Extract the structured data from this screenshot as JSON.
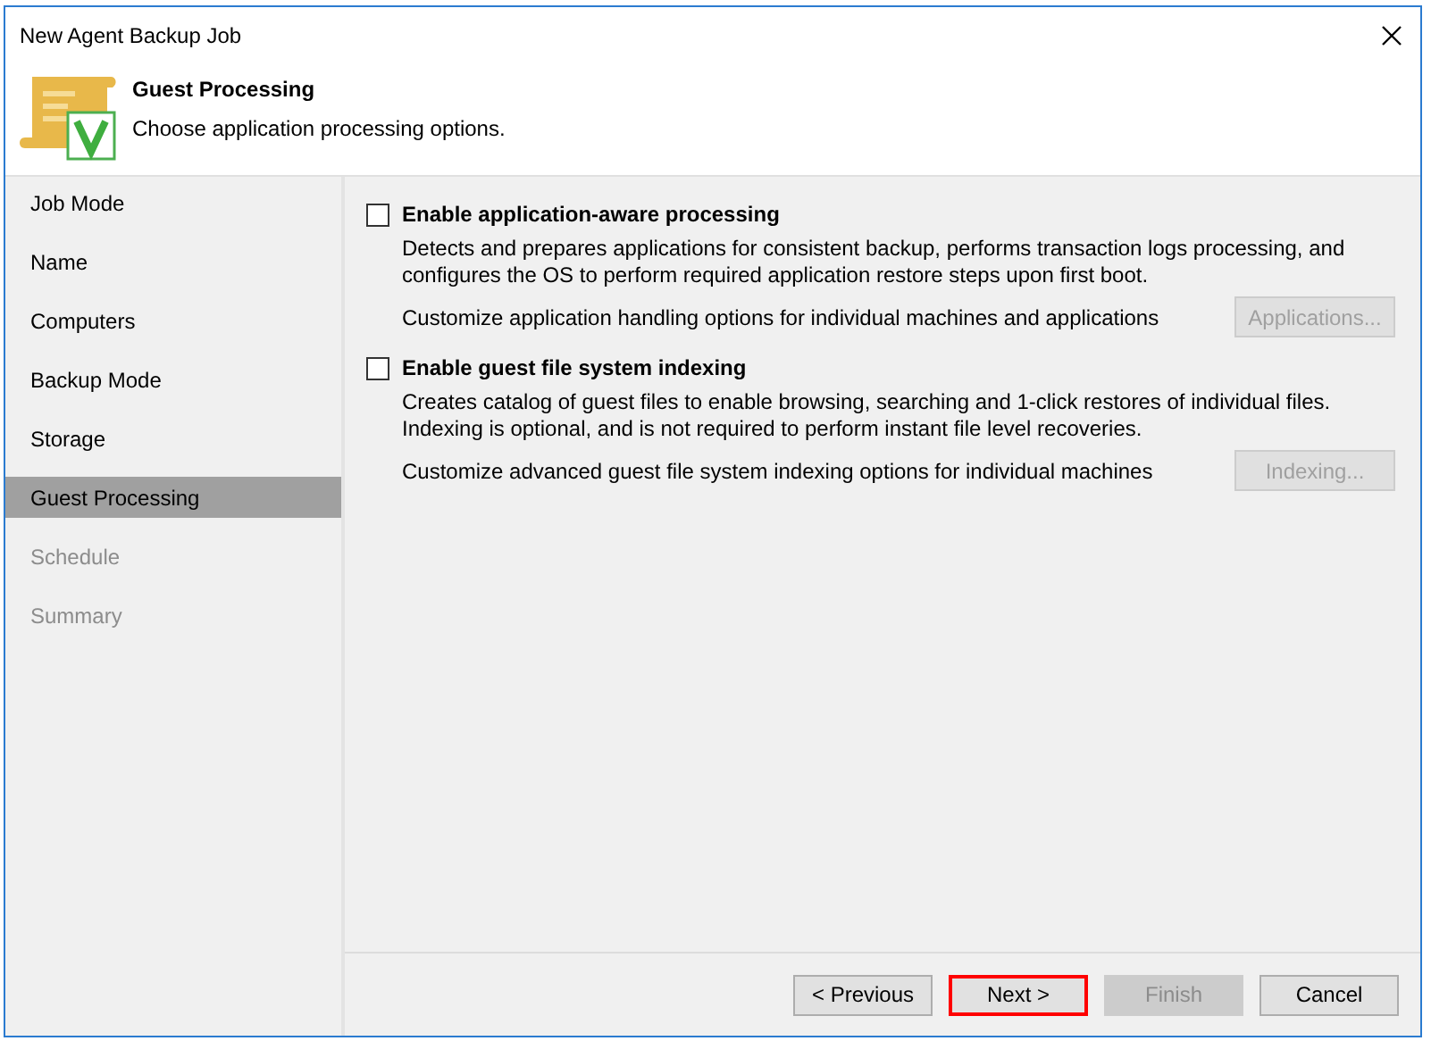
{
  "window": {
    "title": "New Agent Backup Job"
  },
  "header": {
    "title": "Guest Processing",
    "subtitle": "Choose application processing options."
  },
  "sidebar": {
    "items": [
      {
        "label": "Job Mode",
        "selected": false,
        "disabled": false
      },
      {
        "label": "Name",
        "selected": false,
        "disabled": false
      },
      {
        "label": "Computers",
        "selected": false,
        "disabled": false
      },
      {
        "label": "Backup Mode",
        "selected": false,
        "disabled": false
      },
      {
        "label": "Storage",
        "selected": false,
        "disabled": false
      },
      {
        "label": "Guest Processing",
        "selected": true,
        "disabled": false
      },
      {
        "label": "Schedule",
        "selected": false,
        "disabled": true
      },
      {
        "label": "Summary",
        "selected": false,
        "disabled": true
      }
    ]
  },
  "options": [
    {
      "label": "Enable application-aware processing",
      "checked": false,
      "description": "Detects and prepares applications for consistent backup, performs transaction logs processing, and configures the OS to perform required application restore steps upon first boot.",
      "customize_text": "Customize application handling options for individual machines and applications",
      "button": {
        "label": "Applications...",
        "disabled": true
      }
    },
    {
      "label": "Enable guest file system indexing",
      "checked": false,
      "description": "Creates catalog of guest files to enable browsing, searching and 1-click restores of individual files. Indexing is optional, and is not required to perform instant file level recoveries.",
      "customize_text": "Customize advanced guest file system indexing options for individual machines",
      "button": {
        "label": "Indexing...",
        "disabled": true
      }
    }
  ],
  "footer": {
    "buttons": [
      {
        "label": "< Previous",
        "disabled": false,
        "highlighted": false
      },
      {
        "label": "Next >",
        "disabled": false,
        "highlighted": true
      },
      {
        "label": "Finish",
        "disabled": true,
        "highlighted": false
      },
      {
        "label": "Cancel",
        "disabled": false,
        "highlighted": false
      }
    ]
  }
}
